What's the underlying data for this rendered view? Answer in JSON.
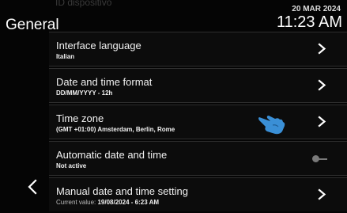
{
  "header": {
    "ghost_text": "ID dispositivo",
    "title": "General",
    "date": "20 MAR 2024",
    "time": "11:23 AM"
  },
  "rows": [
    {
      "label": "Interface language",
      "value": "Italian",
      "control": "chevron-right-icon"
    },
    {
      "label": "Date and time format",
      "value": "DD/MM/YYYY - 12h",
      "control": "chevron-right-icon"
    },
    {
      "label": "Time zone",
      "value": "(GMT +01:00) Amsterdam, Berlin, Rome",
      "control": "chevron-right-icon"
    },
    {
      "label": "Automatic date and time",
      "value": "Not active",
      "control": "toggle-switch",
      "state": "off"
    },
    {
      "label": "Manual date and time setting",
      "value_prefix": "Current value:",
      "value": "19/08/2024 - 6:23 AM",
      "control": "chevron-right-icon"
    }
  ],
  "nav": {
    "back_icon": "chevron-left-icon"
  },
  "overlay": {
    "icon": "pointing-hand-icon",
    "color": "#3a8fd6"
  },
  "colors": {
    "background": "#050505",
    "row": "#0c0c0c",
    "divider": "#2e2e2e",
    "toggle_off": "#7a7a7a"
  }
}
